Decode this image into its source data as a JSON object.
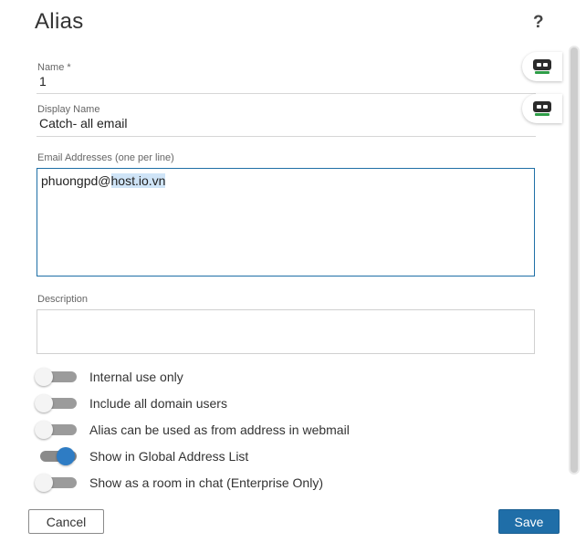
{
  "dialog": {
    "title": "Alias",
    "help_label": "?"
  },
  "form": {
    "name": {
      "label": "Name *",
      "value": "1"
    },
    "display_name": {
      "label": "Display Name",
      "value": "Catch- all email"
    },
    "email_addresses": {
      "label": "Email Addresses (one per line)",
      "value": "phuongpd@host.io.vn",
      "value_prefix": "phuongpd@",
      "value_selected": "host.io.vn"
    },
    "description": {
      "label": "Description",
      "value": ""
    }
  },
  "toggles": [
    {
      "label": "Internal use only",
      "on": false
    },
    {
      "label": "Include all domain users",
      "on": false
    },
    {
      "label": "Alias can be used as from address in webmail",
      "on": false
    },
    {
      "label": "Show in Global Address List",
      "on": true
    },
    {
      "label": "Show as a room in chat (Enterprise Only)",
      "on": false
    }
  ],
  "buttons": {
    "cancel": "Cancel",
    "save": "Save"
  },
  "colors": {
    "accent": "#1f6ea8",
    "toggle_on": "#2e7cc4",
    "selection": "#cfe4f7",
    "bot_mouth": "#2e9d47"
  },
  "icons": {
    "field_assist": "bot-icon"
  }
}
